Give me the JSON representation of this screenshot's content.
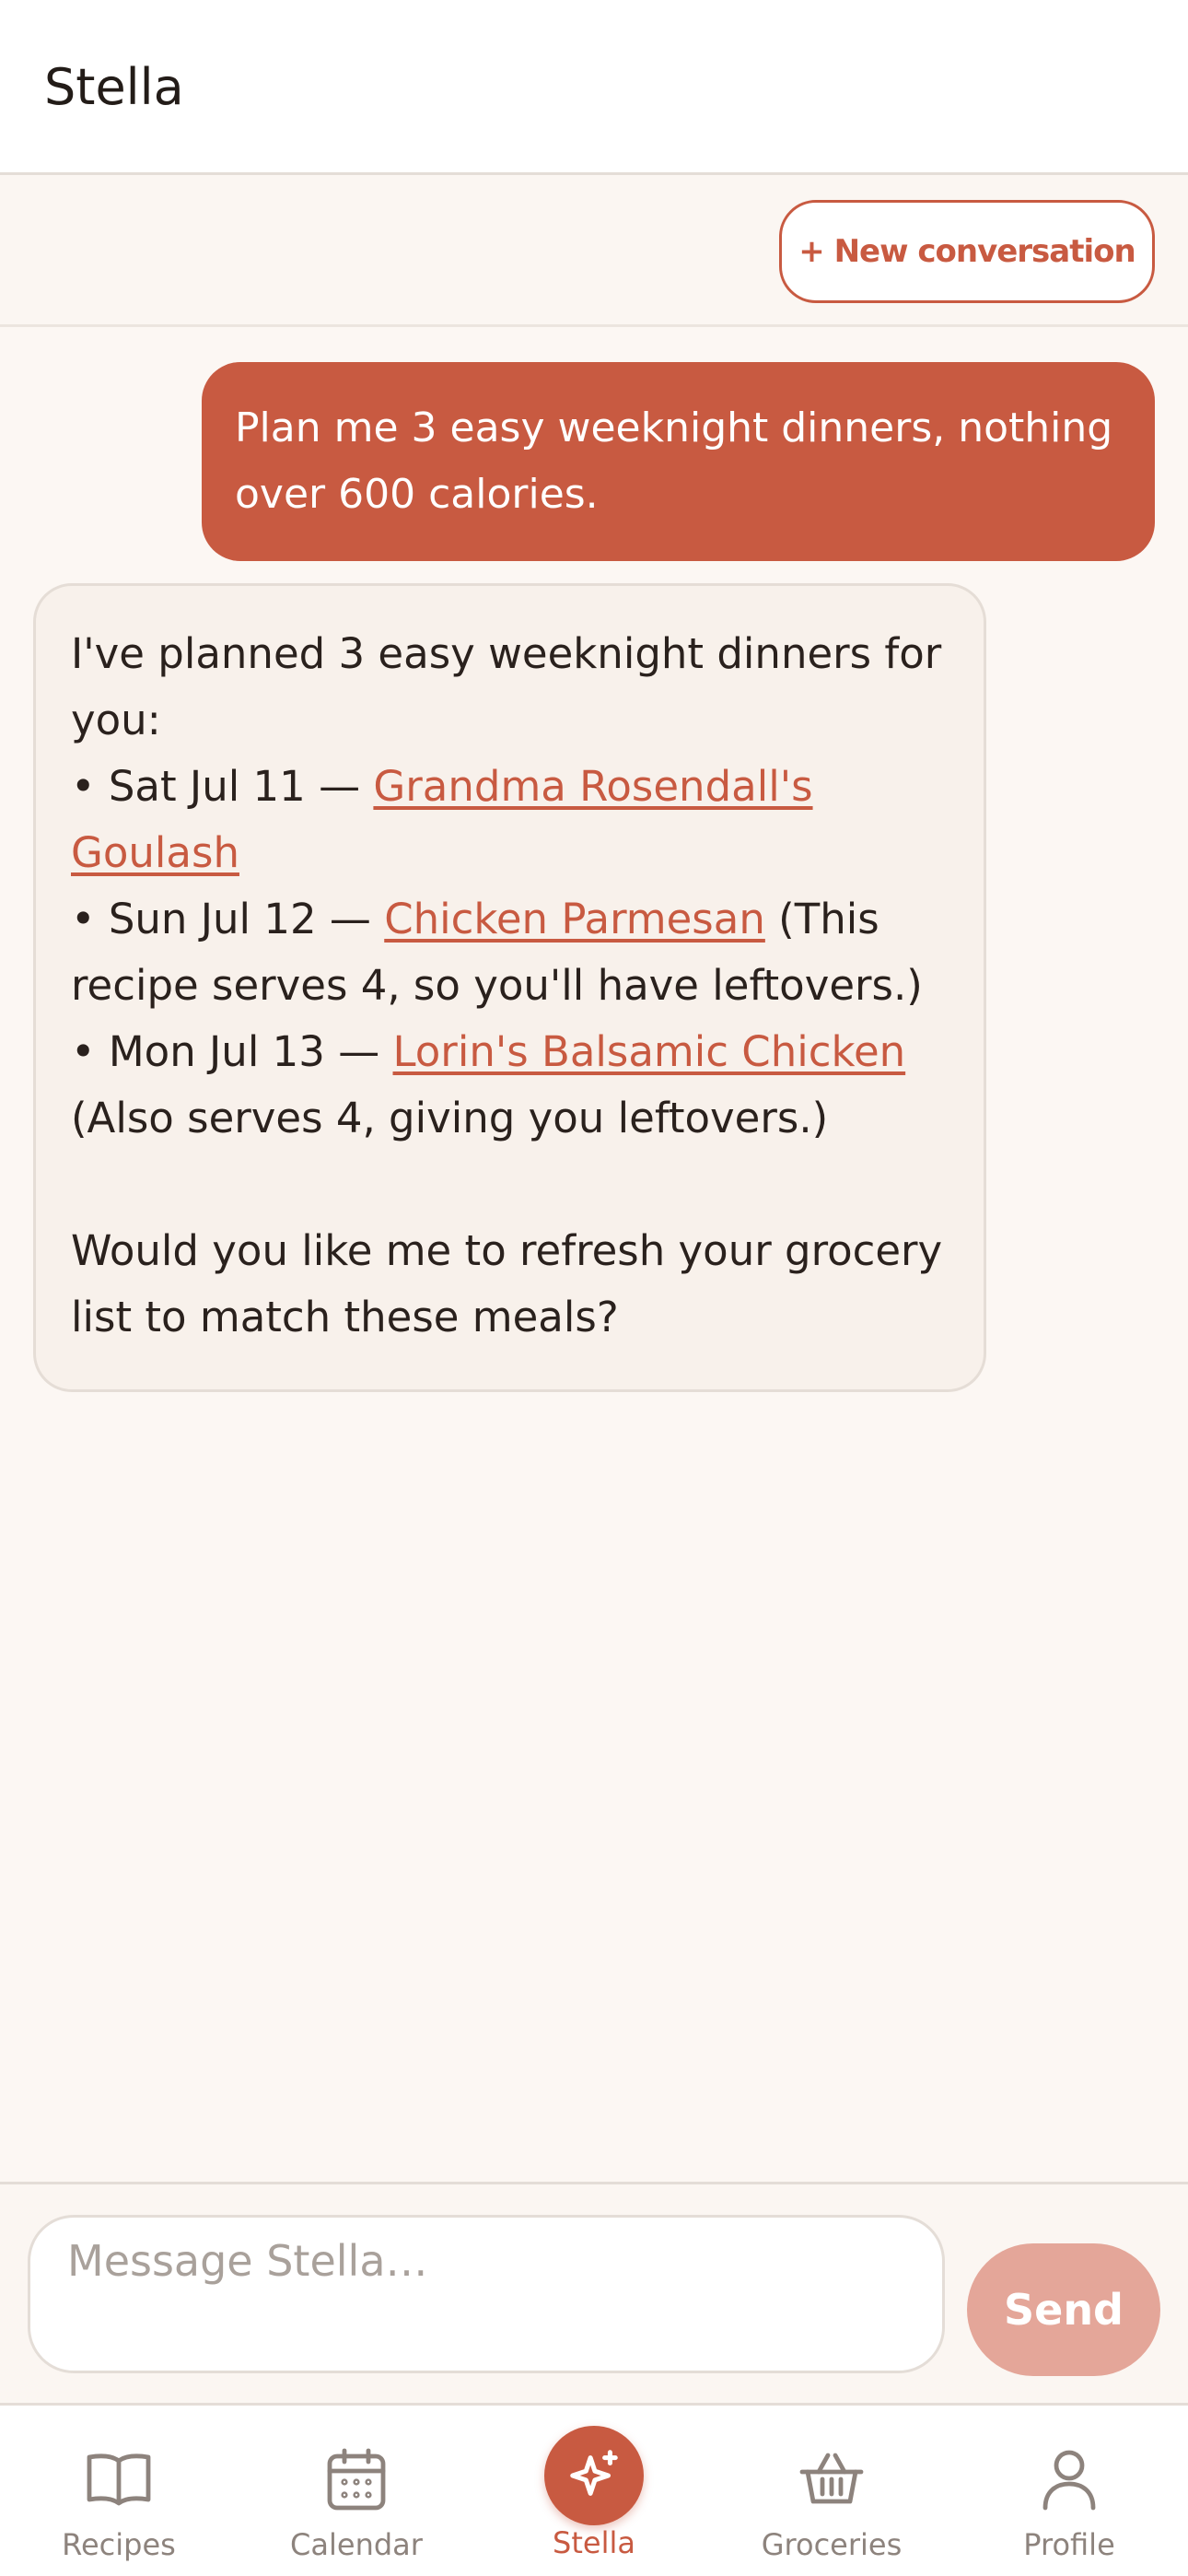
{
  "header": {
    "title": "Stella"
  },
  "toolbar": {
    "new_conversation_label": "+ New conversation"
  },
  "messages": {
    "user_1": "Plan me 3 easy weeknight dinners, nothing over 600 calories.",
    "assistant_1": {
      "intro": "I've planned 3 easy weeknight dinners for you:",
      "items": [
        {
          "prefix": "• Sat Jul 11 — ",
          "recipe": "Grandma Rosendall's Goulash",
          "suffix": ""
        },
        {
          "prefix": "• Sun Jul 12 — ",
          "recipe": "Chicken Parmesan",
          "suffix": " (This recipe serves 4, so you'll have leftovers.)"
        },
        {
          "prefix": "• Mon Jul 13 — ",
          "recipe": "Lorin's Balsamic Chicken",
          "suffix": " (Also serves 4, giving you leftovers.)"
        }
      ],
      "closing": "Would you like me to refresh your grocery list to match these meals?"
    }
  },
  "composer": {
    "placeholder": "Message Stella…",
    "value": "",
    "send_label": "Send"
  },
  "tabs": [
    {
      "label": "Recipes",
      "icon": "book-icon"
    },
    {
      "label": "Calendar",
      "icon": "calendar-icon"
    },
    {
      "label": "Stella",
      "icon": "sparkle-icon",
      "active": true
    },
    {
      "label": "Groceries",
      "icon": "basket-icon"
    },
    {
      "label": "Profile",
      "icon": "person-icon"
    }
  ],
  "colors": {
    "accent": "#c85a41",
    "send_disabled": "#e4a699",
    "background": "#fcf7f3"
  }
}
